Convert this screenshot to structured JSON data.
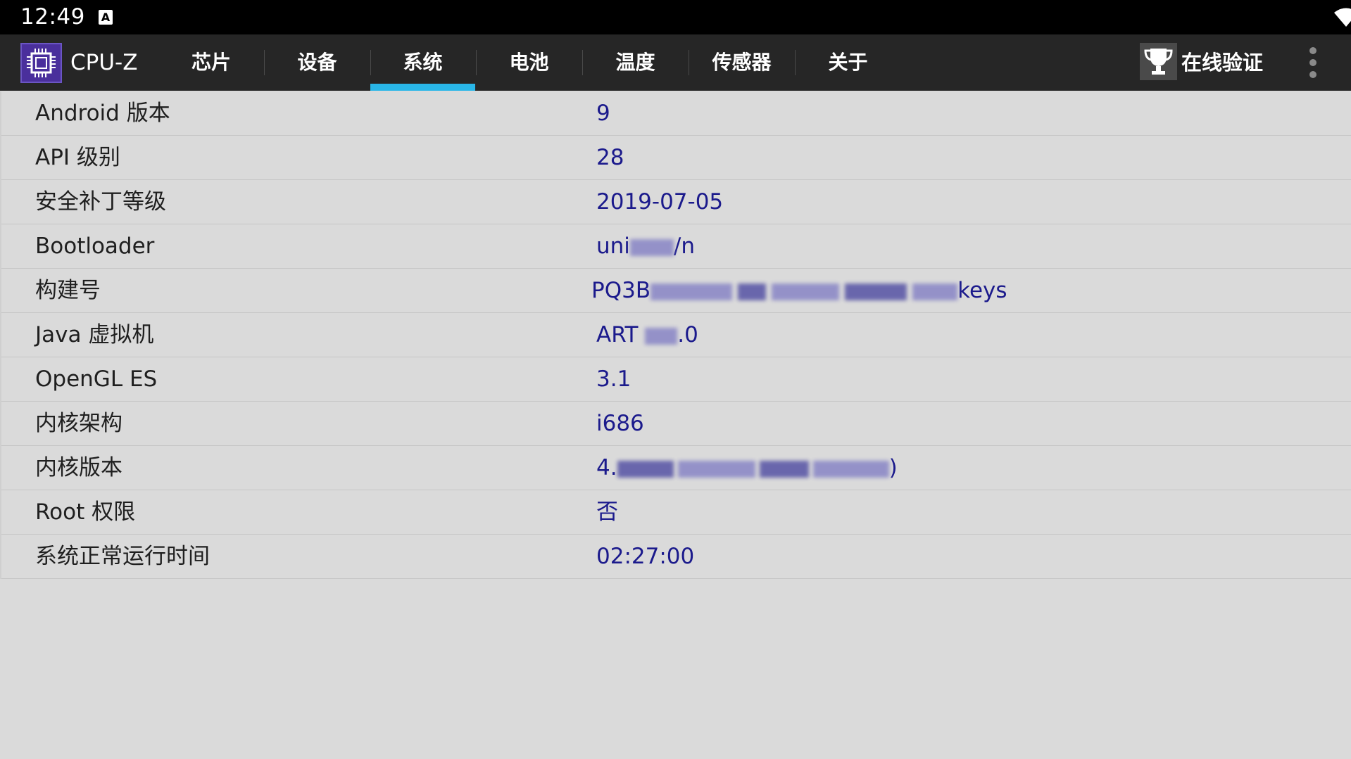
{
  "status_bar": {
    "time": "12:49",
    "notification_icon": "a-icon",
    "right_icons": [
      "wifi-icon",
      "cell-signal-icon",
      "battery-charging-icon"
    ]
  },
  "app_bar": {
    "title": "CPU-Z",
    "logo_icon": "cpu-chip-icon",
    "tabs": [
      {
        "label": "芯片",
        "selected": false
      },
      {
        "label": "设备",
        "selected": false
      },
      {
        "label": "系统",
        "selected": true
      },
      {
        "label": "电池",
        "selected": false
      },
      {
        "label": "温度",
        "selected": false
      },
      {
        "label": "传感器",
        "selected": false
      },
      {
        "label": "关于",
        "selected": false
      }
    ],
    "validate_label": "在线验证",
    "validate_icon": "trophy-icon",
    "overflow_icon": "more-vertical-icon",
    "accent_color": "#29b6e8"
  },
  "system_info": {
    "rows": [
      {
        "label": "Android 版本",
        "value": "9"
      },
      {
        "label": "API 级别",
        "value": "28"
      },
      {
        "label": "安全补丁等级",
        "value": "2019-07-05"
      },
      {
        "label": "Bootloader",
        "value_start": "uni",
        "value_end": "/n",
        "value_blurred": true
      },
      {
        "label": "构建号",
        "value_start": "PQ3B",
        "value_end": "keys",
        "value_blurred": true
      },
      {
        "label": "Java 虚拟机",
        "value_start": "ART ",
        "value_end": ".0",
        "value_blurred": true
      },
      {
        "label": "OpenGL ES",
        "value": "3.1"
      },
      {
        "label": "内核架构",
        "value": "i686"
      },
      {
        "label": "内核版本",
        "value_start": "4.",
        "value_end": ")",
        "value_blurred": true
      },
      {
        "label": "Root 权限",
        "value": "否"
      },
      {
        "label": "系统正常运行时间",
        "value": "02:27:00"
      }
    ],
    "label_color": "#1f1f1f",
    "value_color": "#1b1a8c"
  }
}
